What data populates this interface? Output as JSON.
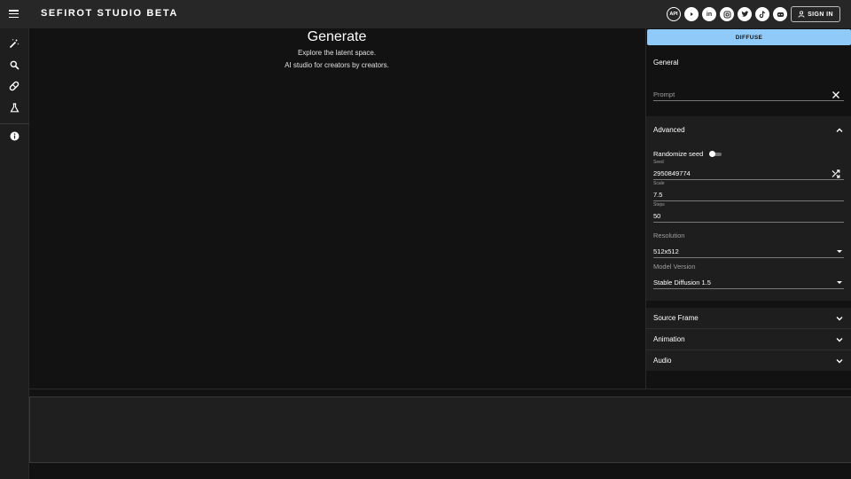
{
  "header": {
    "brand": "SEFIROT STUDIO BETA",
    "api_label": "API",
    "sign_in_label": "SIGN IN"
  },
  "sidebar": {
    "items": [
      {
        "icon": "magic-wand-icon"
      },
      {
        "icon": "search-icon"
      },
      {
        "icon": "pill-icon"
      },
      {
        "icon": "flask-icon"
      },
      {
        "icon": "info-icon"
      }
    ]
  },
  "main": {
    "title": "Generate",
    "subtitle1": "Explore the latent space.",
    "subtitle2": "AI studio for creators by creators."
  },
  "panel": {
    "diffuse_label": "DIFFUSE",
    "general": {
      "title": "General",
      "prompt_placeholder": "Prompt"
    },
    "advanced": {
      "title": "Advanced",
      "randomize_label": "Randomize seed",
      "randomize_on": false,
      "seed_label": "Seed",
      "seed_value": "2950849774",
      "scale_label": "Scale",
      "scale_value": "7.5",
      "steps_label": "Steps",
      "steps_value": "50",
      "resolution_label": "Resolution",
      "resolution_value": "512x512",
      "model_label": "Model Version",
      "model_value": "Stable Diffusion 1.5"
    },
    "accordions": [
      "Source Frame",
      "Animation",
      "Audio"
    ]
  },
  "colors": {
    "accent": "#90caf9",
    "topbar": "#272727",
    "background": "#121212"
  }
}
